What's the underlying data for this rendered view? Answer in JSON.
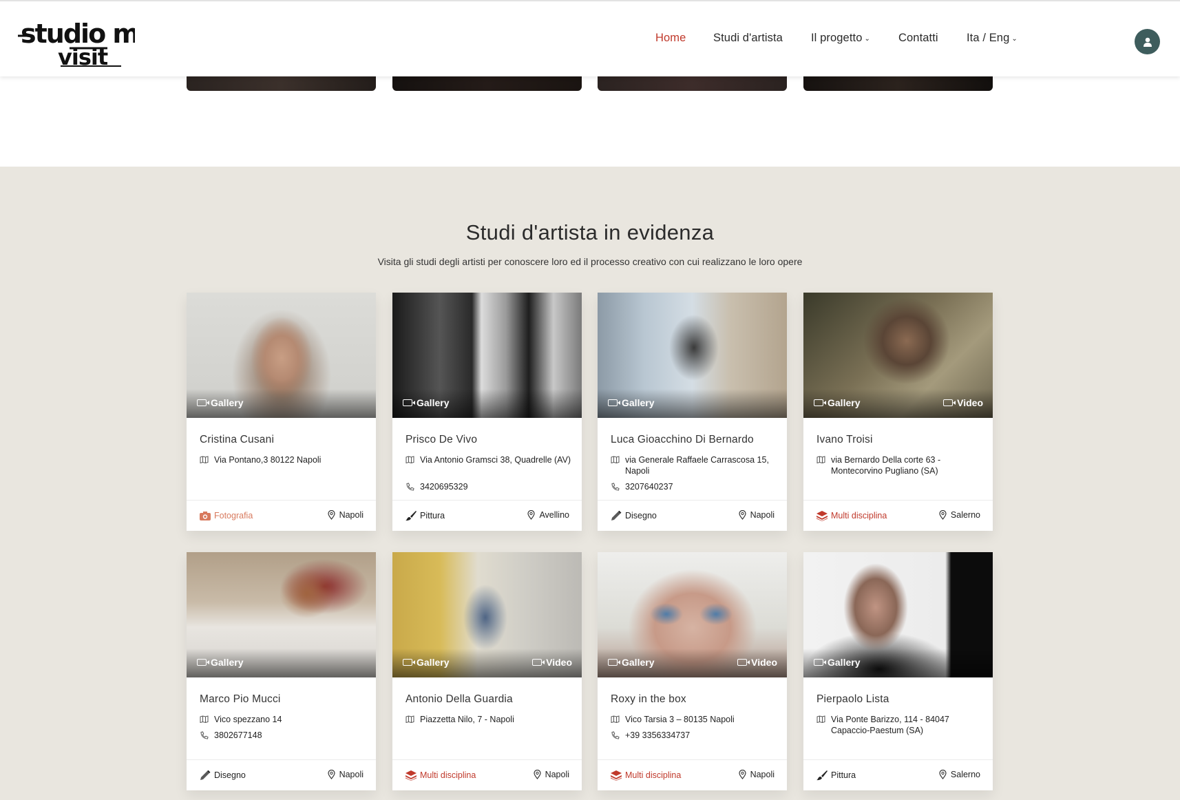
{
  "header": {
    "nav": [
      "Home",
      "Studi d'artista",
      "Il progetto",
      "Contatti",
      "Ita / Eng"
    ],
    "logo_text": "studio me visit"
  },
  "section": {
    "title": "Studi d'artista in evidenza",
    "subtitle": "Visita gli studi degli artisti per conoscere loro ed il processo creativo con cui realizzano le loro opere"
  },
  "cards": [
    {
      "name": "Cristina Cusani",
      "address": "Via Pontano,3 80122 Napoli",
      "phone": "",
      "discipline": "Fotografia",
      "city": "Napoli",
      "gallery": "Gallery",
      "video": ""
    },
    {
      "name": "Prisco De Vivo",
      "address": "Via Antonio Gramsci 38, Quadrelle (AV)",
      "phone": "3420695329",
      "discipline": "Pittura",
      "city": "Avellino",
      "gallery": "Gallery",
      "video": ""
    },
    {
      "name": "Luca Gioacchino Di Bernardo",
      "address": "via Generale Raffaele Carrascosa 15, Napoli",
      "phone": "3207640237",
      "discipline": "Disegno",
      "city": "Napoli",
      "gallery": "Gallery",
      "video": ""
    },
    {
      "name": "Ivano Troisi",
      "address": "via Bernardo Della corte 63 - Montecorvino Pugliano (SA)",
      "phone": "",
      "discipline": "Multi disciplina",
      "city": "Salerno",
      "gallery": "Gallery",
      "video": "Video"
    },
    {
      "name": "Marco Pio Mucci",
      "address": "Vico spezzano 14",
      "phone": "3802677148",
      "discipline": "Disegno",
      "city": "Napoli",
      "gallery": "Gallery",
      "video": ""
    },
    {
      "name": "Antonio Della Guardia",
      "address": "Piazzetta Nilo, 7 - Napoli",
      "phone": "",
      "discipline": "Multi disciplina",
      "city": "Napoli",
      "gallery": "Gallery",
      "video": "Video"
    },
    {
      "name": "Roxy in the box",
      "address": "Vico Tarsia 3 – 80135 Napoli",
      "phone": "+39 3356334737",
      "discipline": "Multi disciplina",
      "city": "Napoli",
      "gallery": "Gallery",
      "video": "Video"
    },
    {
      "name": "Pierpaolo Lista",
      "address": "Via Ponte Barizzo, 114 - 84047 Capaccio-Paestum (SA)",
      "phone": "",
      "discipline": "Pittura",
      "city": "Salerno",
      "gallery": "Gallery",
      "video": ""
    }
  ],
  "colors": {
    "accent": "#c0392b",
    "salmon": "#d87a5e",
    "avatar": "#3e5d5d",
    "section_bg": "#e9e6df"
  }
}
